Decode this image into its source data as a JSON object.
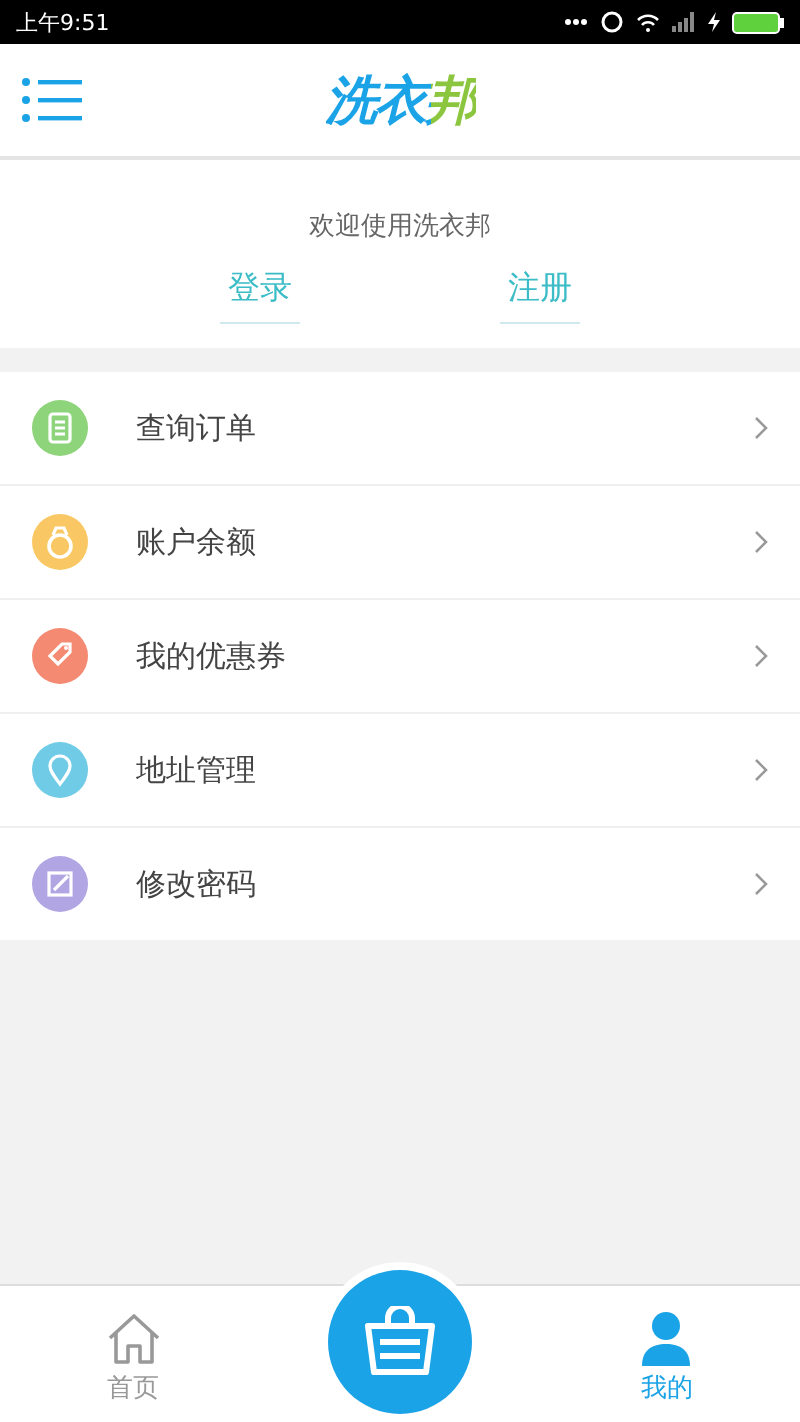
{
  "status_bar": {
    "time": "上午9:51"
  },
  "header": {
    "logo": "洗衣邦"
  },
  "welcome": {
    "text": "欢迎使用洗衣邦",
    "buttons": [
      {
        "label": "登录"
      },
      {
        "label": "注册"
      }
    ]
  },
  "menu": [
    {
      "label": "查询订单",
      "kind": "orders",
      "color": "#8dd47a"
    },
    {
      "label": "账户余额",
      "kind": "balance",
      "color": "#f9c865"
    },
    {
      "label": "我的优惠券",
      "kind": "coupon",
      "color": "#f58a72"
    },
    {
      "label": "地址管理",
      "kind": "address",
      "color": "#6fcbe6"
    },
    {
      "label": "修改密码",
      "kind": "password",
      "color": "#b1a6e3"
    }
  ],
  "tab_bar": [
    {
      "label": "首页",
      "kind": "home",
      "selected": false
    },
    {
      "kind": "basket",
      "selected": false
    },
    {
      "label": "我的",
      "kind": "profile",
      "selected": true
    }
  ]
}
